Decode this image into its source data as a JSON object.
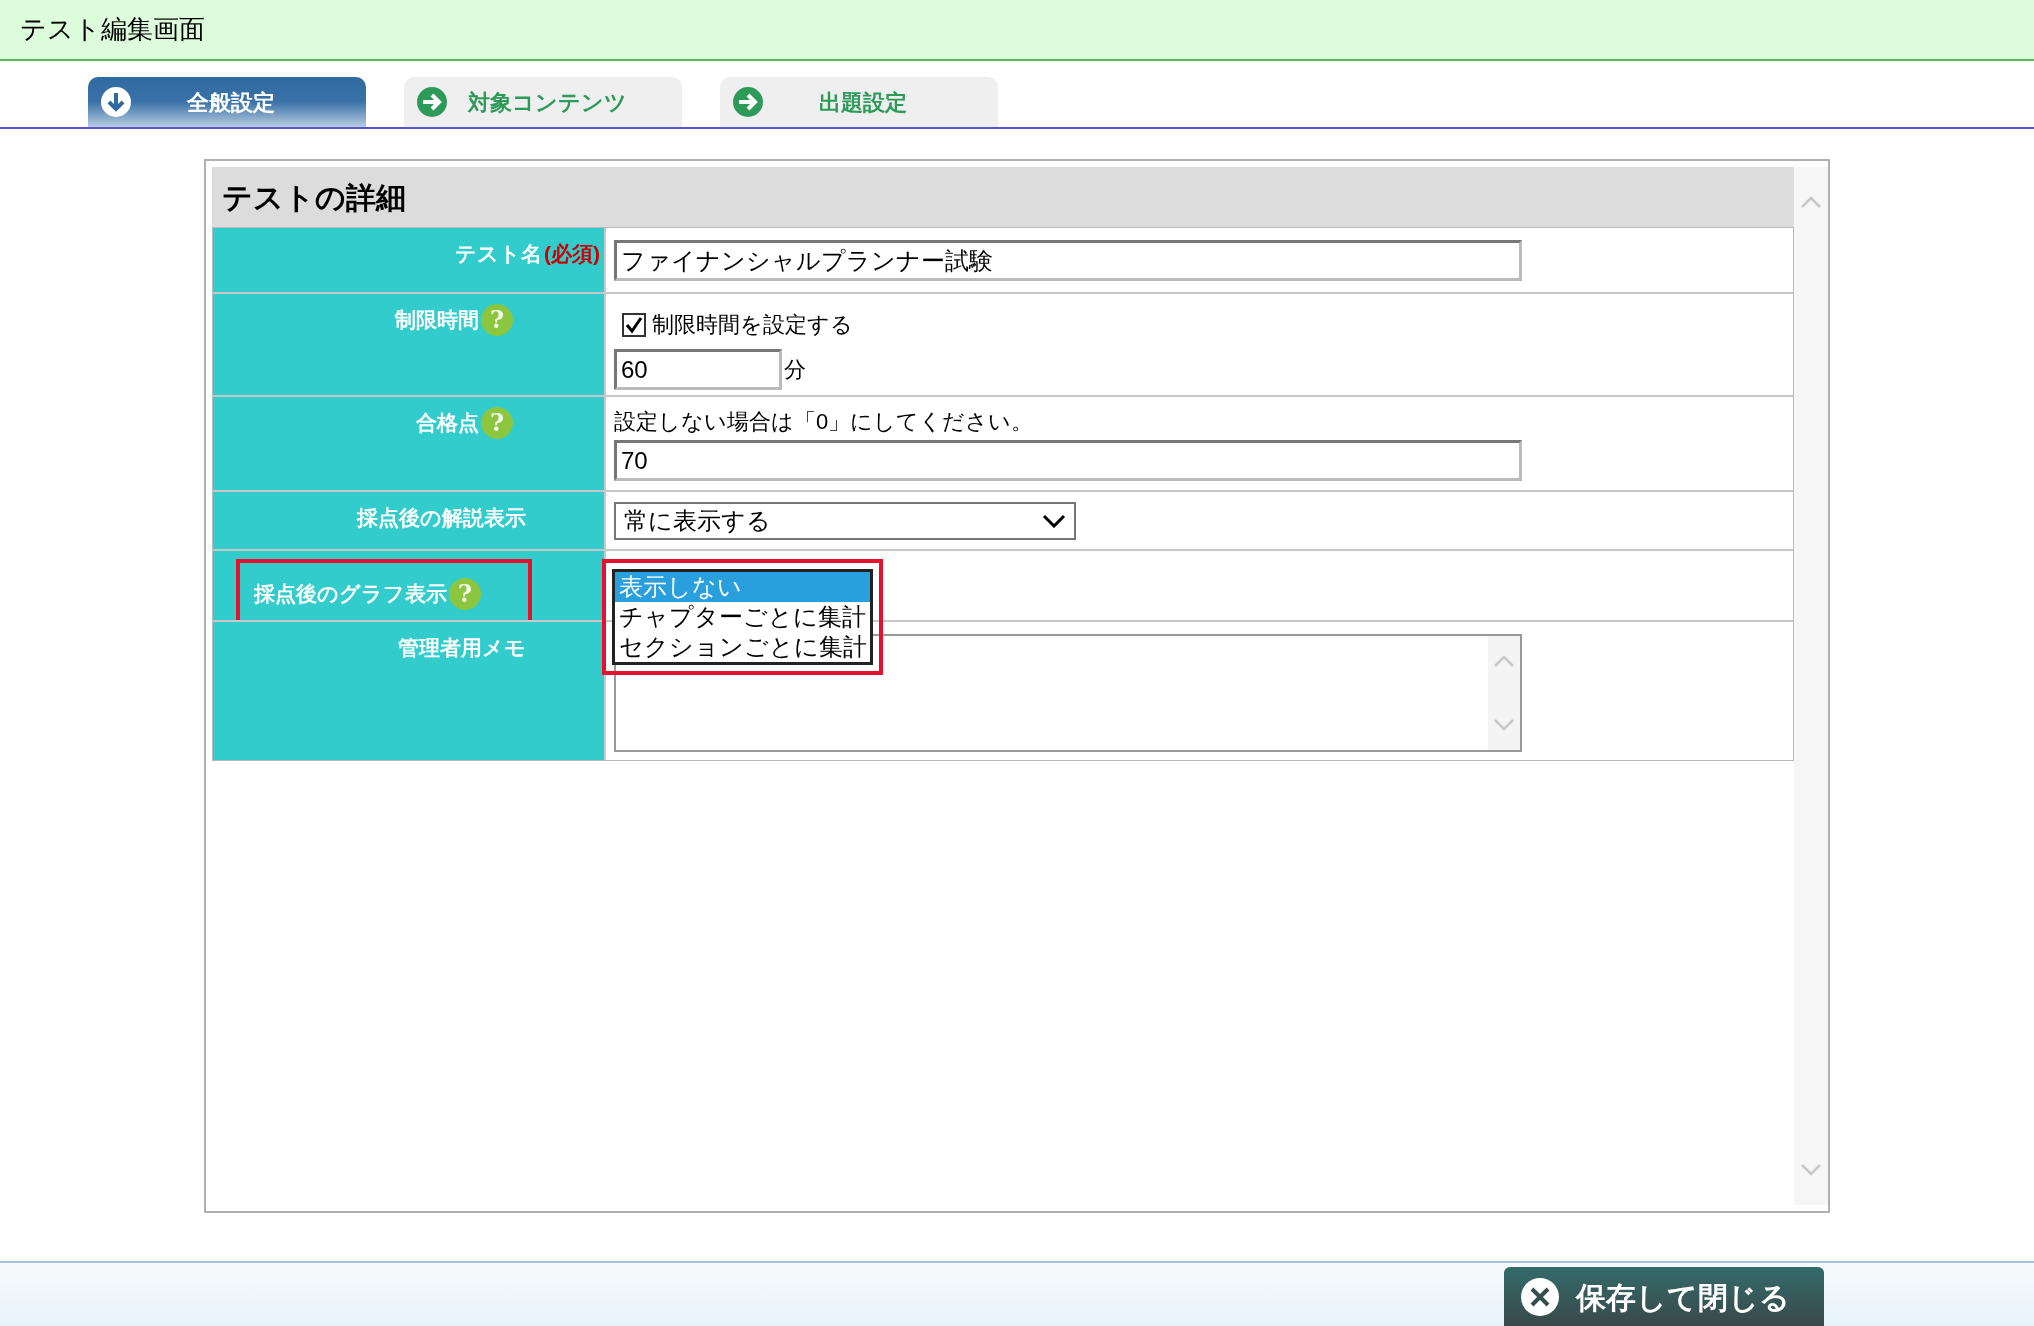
{
  "window": {
    "title": "テスト編集画面"
  },
  "tabs": [
    {
      "label": "全般設定",
      "selected": true
    },
    {
      "label": "対象コンテンツ",
      "selected": false
    },
    {
      "label": "出題設定",
      "selected": false
    }
  ],
  "section": {
    "title": "テストの詳細"
  },
  "rows": [
    {
      "kind": "text",
      "label": "テスト名",
      "required": "(必須)",
      "value": "ファイナンシャルプランナー試験"
    },
    {
      "kind": "time_limit",
      "label": "制限時間",
      "help": "?",
      "checkbox": {
        "label": "制限時間を設定する",
        "checked": true
      },
      "value": "60",
      "unit": "分"
    },
    {
      "kind": "number",
      "label": "合格点",
      "help": "?",
      "note": "設定しない場合は「0」にしてください。",
      "value": "70"
    },
    {
      "kind": "select",
      "label": "採点後の解説表示",
      "value": "常に表示する"
    },
    {
      "kind": "listbox",
      "label": "採点後のグラフ表示",
      "help": "?",
      "highlighted": true,
      "options": [
        {
          "label": "表示しない",
          "selected": true
        },
        {
          "label": "チャプターごとに集計",
          "selected": false
        },
        {
          "label": "セクションごとに集計",
          "selected": false
        }
      ]
    },
    {
      "kind": "textarea",
      "label": "管理者用メモ"
    }
  ],
  "footer": {
    "button": "保存して閉じる"
  }
}
